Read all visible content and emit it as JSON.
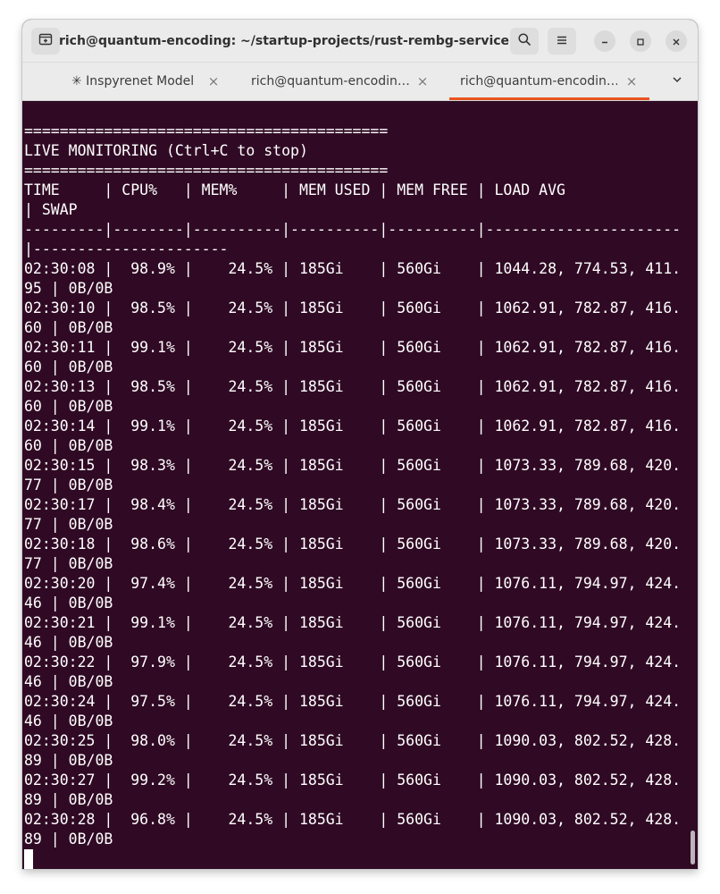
{
  "window": {
    "title": "rich@quantum-encoding: ~/startup-projects/rust-rembg-service",
    "new_tab_icon": "new-tab-icon",
    "search_icon": "search-icon",
    "menu_icon": "hamburger-menu-icon",
    "accent_color": "#e95420",
    "terminal_bg": "#300a24"
  },
  "tabs": [
    {
      "label": "✳ Inspyrenet Model",
      "close": "×",
      "active": false
    },
    {
      "label": "rich@quantum-encodin…",
      "close": "×",
      "active": false
    },
    {
      "label": "rich@quantum-encodin…",
      "close": "×",
      "active": true
    }
  ],
  "terminal": {
    "lines": [
      "=========================================",
      "LIVE MONITORING (Ctrl+C to stop)",
      "=========================================",
      "TIME     | CPU%   | MEM%     | MEM USED | MEM FREE | LOAD AVG",
      "| SWAP",
      "---------|--------|----------|----------|----------|----------------------",
      "|----------------------",
      "02:30:08 |  98.9% |    24.5% | 185Gi    | 560Gi    | 1044.28, 774.53, 411.",
      "95 | 0B/0B",
      "02:30:10 |  98.5% |    24.5% | 185Gi    | 560Gi    | 1062.91, 782.87, 416.",
      "60 | 0B/0B",
      "02:30:11 |  99.1% |    24.5% | 185Gi    | 560Gi    | 1062.91, 782.87, 416.",
      "60 | 0B/0B",
      "02:30:13 |  98.5% |    24.5% | 185Gi    | 560Gi    | 1062.91, 782.87, 416.",
      "60 | 0B/0B",
      "02:30:14 |  99.1% |    24.5% | 185Gi    | 560Gi    | 1062.91, 782.87, 416.",
      "60 | 0B/0B",
      "02:30:15 |  98.3% |    24.5% | 185Gi    | 560Gi    | 1073.33, 789.68, 420.",
      "77 | 0B/0B",
      "02:30:17 |  98.4% |    24.5% | 185Gi    | 560Gi    | 1073.33, 789.68, 420.",
      "77 | 0B/0B",
      "02:30:18 |  98.6% |    24.5% | 185Gi    | 560Gi    | 1073.33, 789.68, 420.",
      "77 | 0B/0B",
      "02:30:20 |  97.4% |    24.5% | 185Gi    | 560Gi    | 1076.11, 794.97, 424.",
      "46 | 0B/0B",
      "02:30:21 |  99.1% |    24.5% | 185Gi    | 560Gi    | 1076.11, 794.97, 424.",
      "46 | 0B/0B",
      "02:30:22 |  97.9% |    24.5% | 185Gi    | 560Gi    | 1076.11, 794.97, 424.",
      "46 | 0B/0B",
      "02:30:24 |  97.5% |    24.5% | 185Gi    | 560Gi    | 1076.11, 794.97, 424.",
      "46 | 0B/0B",
      "02:30:25 |  98.0% |    24.5% | 185Gi    | 560Gi    | 1090.03, 802.52, 428.",
      "89 | 0B/0B",
      "02:30:27 |  99.2% |    24.5% | 185Gi    | 560Gi    | 1090.03, 802.52, 428.",
      "89 | 0B/0B",
      "02:30:28 |  96.8% |    24.5% | 185Gi    | 560Gi    | 1090.03, 802.52, 428.",
      "89 | 0B/0B"
    ]
  }
}
